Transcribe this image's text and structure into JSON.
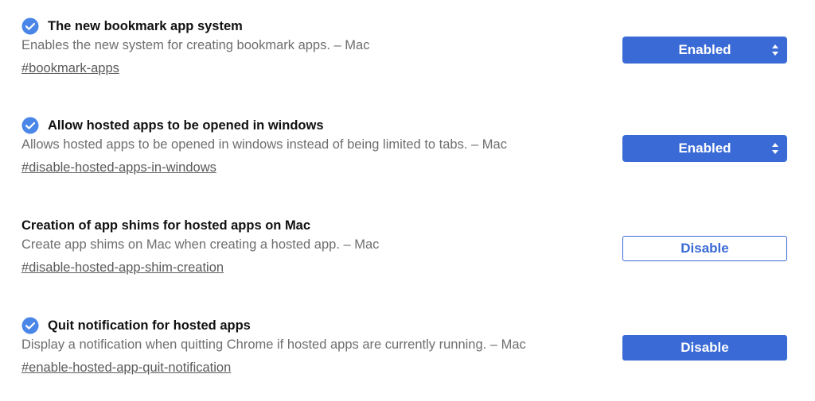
{
  "colors": {
    "accent": "#3a6ad6",
    "check": "#4a86e8",
    "description": "#6e6e6e",
    "link": "#5a5a5a"
  },
  "flags": [
    {
      "title": "The new bookmark app system",
      "description": "Enables the new system for creating bookmark apps.  – Mac",
      "link": "#bookmark-apps",
      "checked_icon": "check-circle-icon",
      "control": {
        "type": "select",
        "selected": "Enabled"
      }
    },
    {
      "title": "Allow hosted apps to be opened in windows",
      "description": "Allows hosted apps to be opened in windows instead of being limited to tabs.  – Mac",
      "link": "#disable-hosted-apps-in-windows",
      "checked_icon": "check-circle-icon",
      "control": {
        "type": "select",
        "selected": "Enabled"
      }
    },
    {
      "title": "Creation of app shims for hosted apps on Mac",
      "description": "Create app shims on Mac when creating a hosted app.  – Mac",
      "link": "#disable-hosted-app-shim-creation",
      "checked_icon": "",
      "control": {
        "type": "button-outline",
        "label": "Disable"
      }
    },
    {
      "title": "Quit notification for hosted apps",
      "description": "Display a notification when quitting Chrome if hosted apps are currently running.  – Mac",
      "link": "#enable-hosted-app-quit-notification",
      "checked_icon": "check-circle-icon",
      "control": {
        "type": "button-filled",
        "label": "Disable"
      }
    }
  ]
}
